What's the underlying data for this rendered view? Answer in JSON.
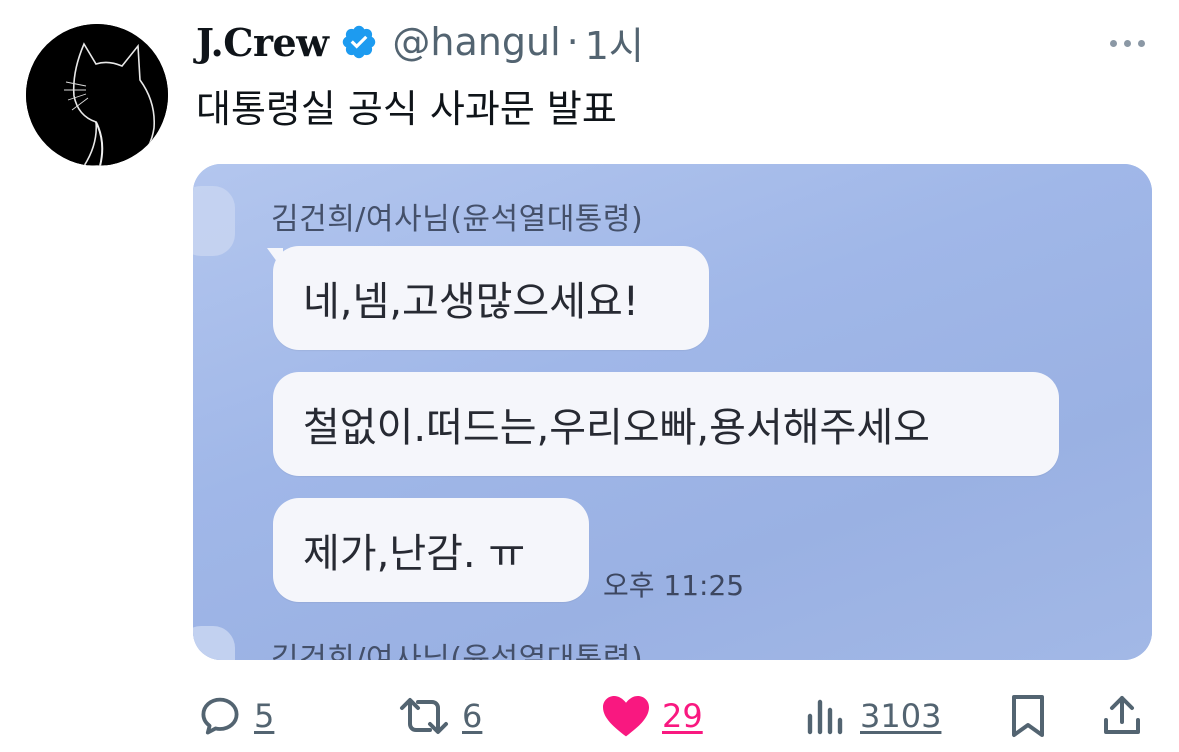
{
  "tweet": {
    "display_name": "J.Crew",
    "handle": "@hangul",
    "separator": "·",
    "time": "1시",
    "text": "대통령실 공식 사과문 발표"
  },
  "media": {
    "sender": "김건희/여사님(윤석열대통령)",
    "messages": [
      "네,넴,고생많으세요!",
      "철없이.떠드는,우리오빠,용서해주세오",
      "제가,난감. ㅠ"
    ],
    "message_time": "오후 11:25",
    "sender_partial": "김건희/여사님(윤석열대통령)"
  },
  "actions": {
    "replies": "5",
    "retweets": "6",
    "likes": "29",
    "views": "3103"
  },
  "colors": {
    "like_active": "#f91880",
    "verified": "#1d9bf0",
    "muted": "#536471"
  }
}
